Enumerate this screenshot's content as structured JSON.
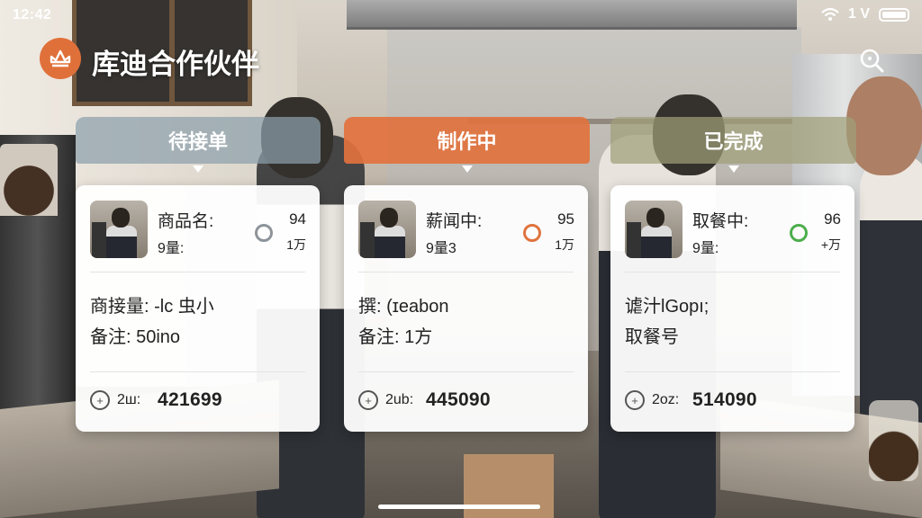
{
  "status_bar": {
    "time": "12:42",
    "right_text": "1 V"
  },
  "header": {
    "app_title": "库迪合作伙伴"
  },
  "columns": [
    {
      "tab_label": "待接单",
      "tab_color": "#8ca0aa",
      "card": {
        "title": "商品名:",
        "qty": "9量:",
        "number_top": "94",
        "number_bottom": "1万",
        "ring_color": "#8d949a",
        "detail1": "商接量: ‐lc 虫小",
        "detail2": "备注: 50ino",
        "footer_label": "2ш:",
        "footer_value": "421699"
      }
    },
    {
      "tab_label": "制作中",
      "tab_color": "#e2723e",
      "card": {
        "title": "薪闻中:",
        "qty": "9量3",
        "number_top": "95",
        "number_bottom": "1万",
        "ring_color": "#e0733e",
        "detail1": "撰: (ɪeabon",
        "detail2": "备注: 1方",
        "footer_label": "2ub:",
        "footer_value": "445090"
      }
    },
    {
      "tab_label": "已完成",
      "tab_color": "#a0a078",
      "card": {
        "title": "取餐中:",
        "qty": "9量:",
        "number_top": "96",
        "number_bottom": "+万",
        "ring_color": "#4cae4c",
        "detail1": "谑汁lGopı;",
        "detail2": "取餐号",
        "footer_label": "2oz:",
        "footer_value": "514090"
      }
    }
  ]
}
